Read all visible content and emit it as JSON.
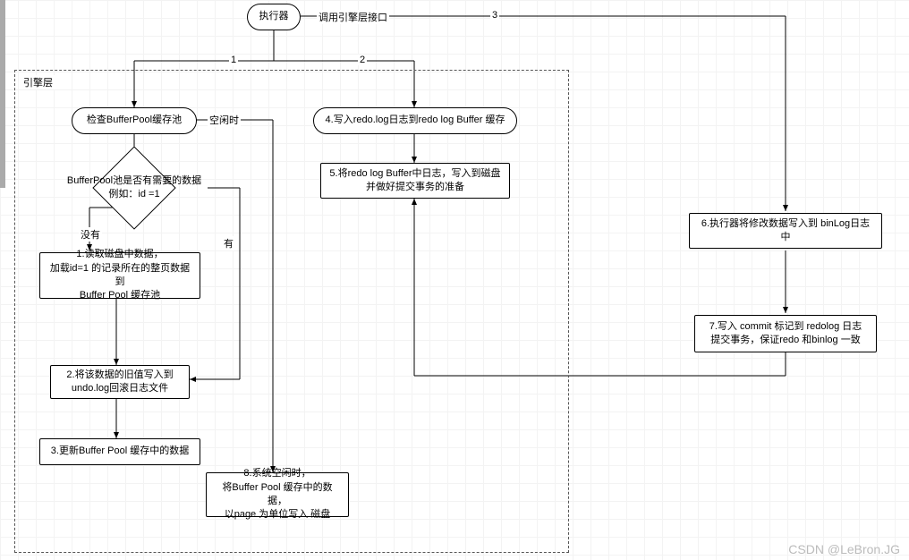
{
  "executor": "执行器",
  "engineLayerLabel": "引擎层",
  "edgeLabels": {
    "callEngine": "调用引擎层接口",
    "one": "1",
    "two": "2",
    "three": "3",
    "idle": "空闲时",
    "noData": "没有",
    "hasData": "有"
  },
  "nodes": {
    "checkBuffer": "检查BufferPool缓存池",
    "hasData": "BufferPool池是否有需要的数据\n例如：id =1",
    "step1": "1.读取磁盘中数据，\n加载id=1 的记录所在的整页数据到\nBuffer Pool 缓存池",
    "step2": "2.将该数据的旧值写入到\nundo.log回滚日志文件",
    "step3": "3.更新Buffer Pool 缓存中的数据",
    "step4": "4.写入redo.log日志到redo log Buffer 缓存",
    "step5": "5.将redo log Buffer中日志，写入到磁盘\n并做好提交事务的准备",
    "step6": "6.执行器将修改数据写入到 binLog日志中",
    "step7": "7.写入 commit 标记到 redolog 日志\n提交事务，保证redo 和binlog 一致",
    "step8": "8.系统空闲时，\n将Buffer Pool 缓存中的数据，\n以page 为单位写入 磁盘"
  },
  "watermark": "CSDN @LeBron.JG"
}
